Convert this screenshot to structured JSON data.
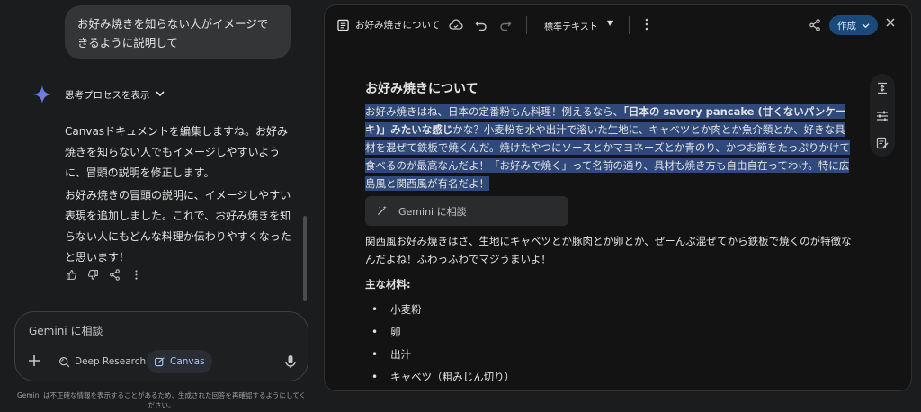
{
  "chat": {
    "user_message": "お好み焼きを知らない人がイメージできるように説明して",
    "thinking_label": "思考プロセスを表示",
    "answer_p1": "Canvasドキュメントを編集しますね。お好み焼きを知らない人でもイメージしやすいように、冒頭の説明を修正します。",
    "answer_p2": "お好み焼きの冒頭の説明に、イメージしやすい表現を追加しました。これで、お好み焼きを知らない人にもどんな料理か伝わりやすくなったと思います！",
    "actions": [
      "thumb-up-icon",
      "thumb-down-icon",
      "share-icon",
      "more-vert-icon"
    ]
  },
  "input": {
    "placeholder": "Gemini に相談",
    "deep_research_label": "Deep Research",
    "canvas_label": "Canvas",
    "disclaimer": "Gemini は不正確な情報を表示することがあるため、生成された回答を再確認するようにしてください。"
  },
  "canvas": {
    "toolbar_title": "お好み焼きについて",
    "text_style": "標準テキスト",
    "create_label": "作成",
    "doc_title": "お好み焼きについて",
    "sel_part1": "お好み焼きはね、日本の定番粉もん料理！例えるなら、",
    "sel_bold": "「日本の savory pancake (甘くないパンケーキ)」みたいな感じ",
    "sel_part2": "かな？小麦粉を水や出汁で溶いた生地に、キャベツとか肉とか魚介類とか、好きな具材を混ぜて鉄板で焼くんだ。焼けたやつにソースとかマヨネーズとか青のり、かつお節をたっぷりかけて食べるのが最高なんだよ！「お好みで焼く」って名前の通り、具材も焼き方も自由自在ってわけ。特に広島風と関西風が有名だよ！",
    "ask_popup": "Gemini に相談",
    "para2": "関西風お好み焼きはさ、生地にキャベツとか豚肉とか卵とか、ぜーんぶ混ぜてから鉄板で焼くのが特徴なんだよね！ふわっふわでマジうまいよ！",
    "materials_heading": "主な材料:",
    "materials": [
      "小麦粉",
      "卵",
      "出汁",
      "キャベツ（粗みじん切り）"
    ]
  },
  "colors": {
    "background": "#1b1c1d",
    "selection": "#2f4a7a",
    "create_button": "#1a4a7a",
    "accent": "#a8c7fa"
  }
}
